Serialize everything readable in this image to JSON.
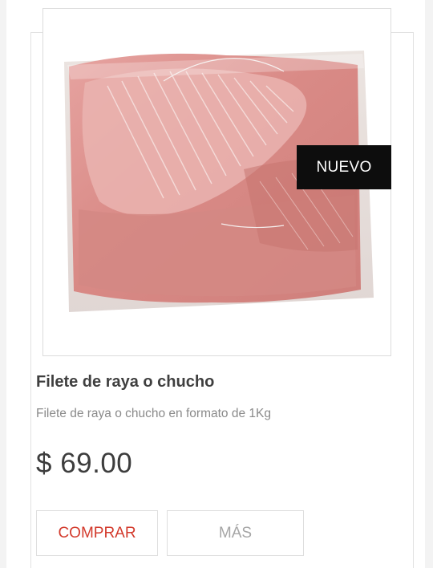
{
  "product": {
    "badge": "NUEVO",
    "title": "Filete de raya o chucho",
    "description": "Filete de raya o chucho en formato de 1Kg",
    "price": "$ 69.00",
    "image_icon": "fish-fillet-package-image"
  },
  "actions": {
    "buy_label": "COMPRAR",
    "more_label": "MÁS"
  },
  "colors": {
    "accent": "#d33a2c",
    "badge_bg": "#0d0d0d",
    "title": "#3f3f3f",
    "muted": "#8a8a8a"
  }
}
